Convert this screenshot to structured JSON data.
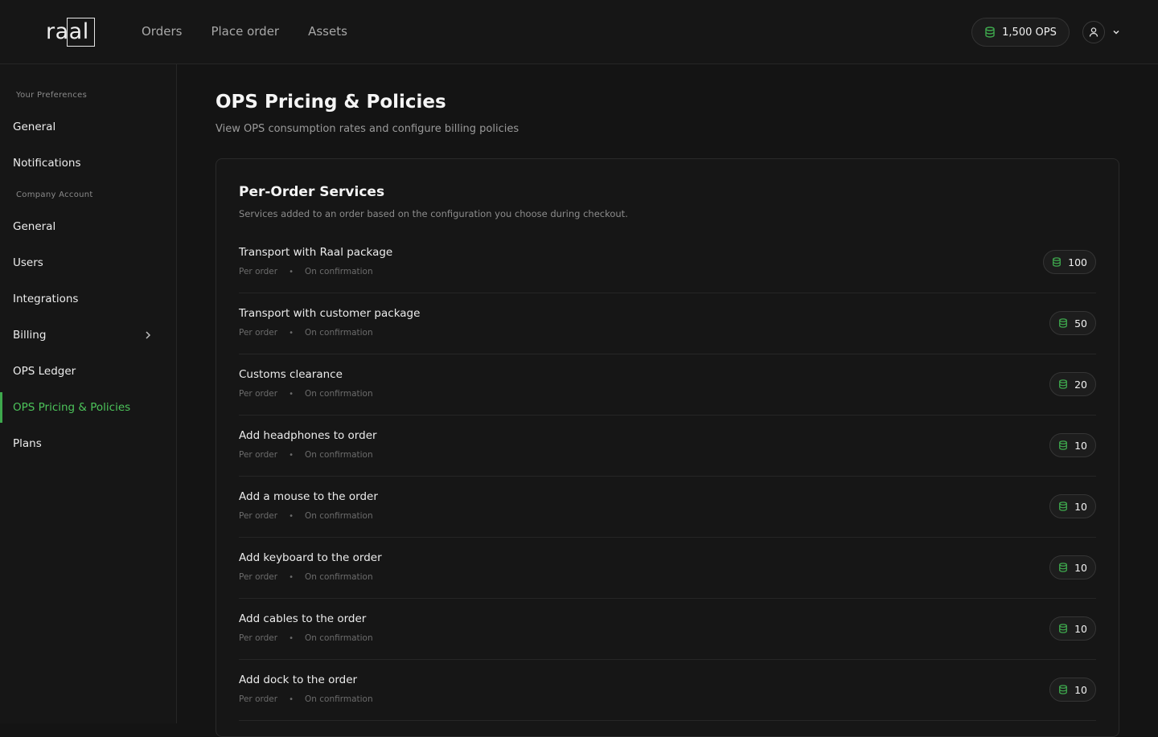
{
  "app": {
    "logo_text": "raal"
  },
  "top_nav": [
    {
      "label": "Orders"
    },
    {
      "label": "Place order"
    },
    {
      "label": "Assets"
    }
  ],
  "balance": {
    "label": "1,500 OPS",
    "icon": "coins-stack-icon"
  },
  "user_menu": {
    "icon": "user-icon",
    "chevron": "chevron-down-icon"
  },
  "sidebar": {
    "preferences_heading": "Your Preferences",
    "preferences_items": [
      {
        "label": "General"
      },
      {
        "label": "Notifications"
      }
    ],
    "company_heading": "Company Account",
    "company_items": [
      {
        "label": "General"
      },
      {
        "label": "Users"
      },
      {
        "label": "Integrations"
      },
      {
        "label": "Billing",
        "has_chevron": true
      },
      {
        "label": "OPS Ledger"
      },
      {
        "label": "OPS Pricing & Policies",
        "active": true
      },
      {
        "label": "Plans"
      }
    ]
  },
  "page": {
    "title": "OPS Pricing & Policies",
    "subtitle": "View OPS consumption rates and configure billing policies"
  },
  "section": {
    "title": "Per-Order Services",
    "description": "Services added to an order based on the configuration you choose during checkout.",
    "services": [
      {
        "name": "Transport with Raal package",
        "frequency": "Per order",
        "trigger": "On confirmation",
        "cost": "100"
      },
      {
        "name": "Transport with customer package",
        "frequency": "Per order",
        "trigger": "On confirmation",
        "cost": "50"
      },
      {
        "name": "Customs clearance",
        "frequency": "Per order",
        "trigger": "On confirmation",
        "cost": "20"
      },
      {
        "name": "Add headphones to order",
        "frequency": "Per order",
        "trigger": "On confirmation",
        "cost": "10"
      },
      {
        "name": "Add a mouse to the order",
        "frequency": "Per order",
        "trigger": "On confirmation",
        "cost": "10"
      },
      {
        "name": "Add keyboard to the order",
        "frequency": "Per order",
        "trigger": "On confirmation",
        "cost": "10"
      },
      {
        "name": "Add cables to the order",
        "frequency": "Per order",
        "trigger": "On confirmation",
        "cost": "10"
      },
      {
        "name": "Add dock to the order",
        "frequency": "Per order",
        "trigger": "On confirmation",
        "cost": "10"
      }
    ]
  },
  "colors": {
    "accent": "#3ea84d",
    "background": "#141414",
    "surface": "#161616"
  }
}
